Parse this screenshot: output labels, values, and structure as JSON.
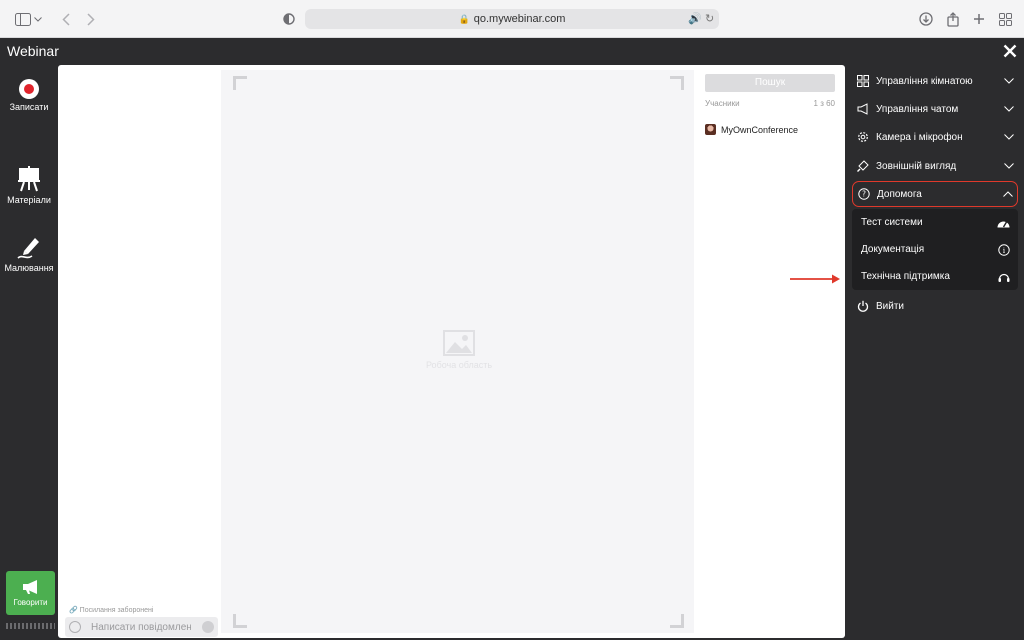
{
  "browser": {
    "url": "qo.mywebinar.com"
  },
  "app": {
    "title": "Webinar"
  },
  "toolbar": {
    "record_label": "Записати",
    "materials_label": "Матеріали",
    "drawing_label": "Малювання",
    "speak_label": "Говорити"
  },
  "chat": {
    "links_note": "Посилання заборонені",
    "input_placeholder": "Написати повідомлення"
  },
  "presentation": {
    "placeholder_text": "Робоча область"
  },
  "participants": {
    "search_label": "Пошук",
    "header_label": "Учасники",
    "count": "1 з 60",
    "items": [
      {
        "name": "MyOwnConference"
      }
    ]
  },
  "menu": {
    "items": [
      {
        "label": "Управління кімнатою",
        "icon": "grid-icon"
      },
      {
        "label": "Управління чатом",
        "icon": "megaphone-icon"
      },
      {
        "label": "Камера і мікрофон",
        "icon": "gear-icon"
      },
      {
        "label": "Зовнішній вигляд",
        "icon": "brush-icon"
      },
      {
        "label": "Допомога",
        "icon": "help-circle-icon"
      }
    ],
    "help_submenu": [
      {
        "label": "Тест системи",
        "icon": "speedometer-icon"
      },
      {
        "label": "Документація",
        "icon": "info-icon"
      },
      {
        "label": "Технічна підтримка",
        "icon": "headset-icon"
      }
    ],
    "logout_label": "Вийти"
  },
  "colors": {
    "app_background": "#2c2c2e",
    "record_red": "#e0242c",
    "speak_green": "#4caf50",
    "highlight_red": "#e0392b"
  }
}
